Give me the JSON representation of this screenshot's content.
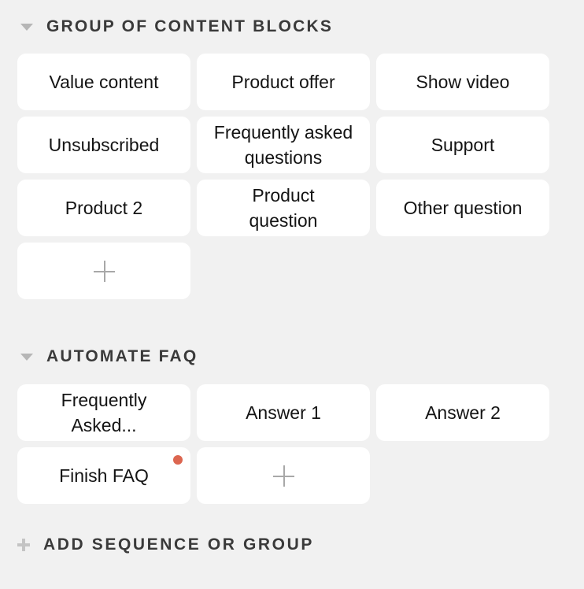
{
  "groups": [
    {
      "title": "GROUP OF CONTENT BLOCKS",
      "expanded": true,
      "blocks": [
        {
          "label": "Value content"
        },
        {
          "label": "Product offer"
        },
        {
          "label": "Show video"
        },
        {
          "label": "Unsubscribed"
        },
        {
          "label": "Frequently asked questions"
        },
        {
          "label": "Support"
        },
        {
          "label": "Product 2"
        },
        {
          "label": "Product question"
        },
        {
          "label": "Other question"
        }
      ],
      "add_block_icon": "plus-icon"
    },
    {
      "title": "AUTOMATE FAQ",
      "expanded": true,
      "blocks": [
        {
          "label": "Frequently Asked..."
        },
        {
          "label": "Answer 1"
        },
        {
          "label": "Answer 2"
        },
        {
          "label": "Finish FAQ",
          "notification_dot": true,
          "dot_color": "#dc6650"
        }
      ],
      "add_block_icon": "plus-icon"
    }
  ],
  "footer": {
    "label": "ADD SEQUENCE OR GROUP",
    "icon": "plus-icon"
  }
}
